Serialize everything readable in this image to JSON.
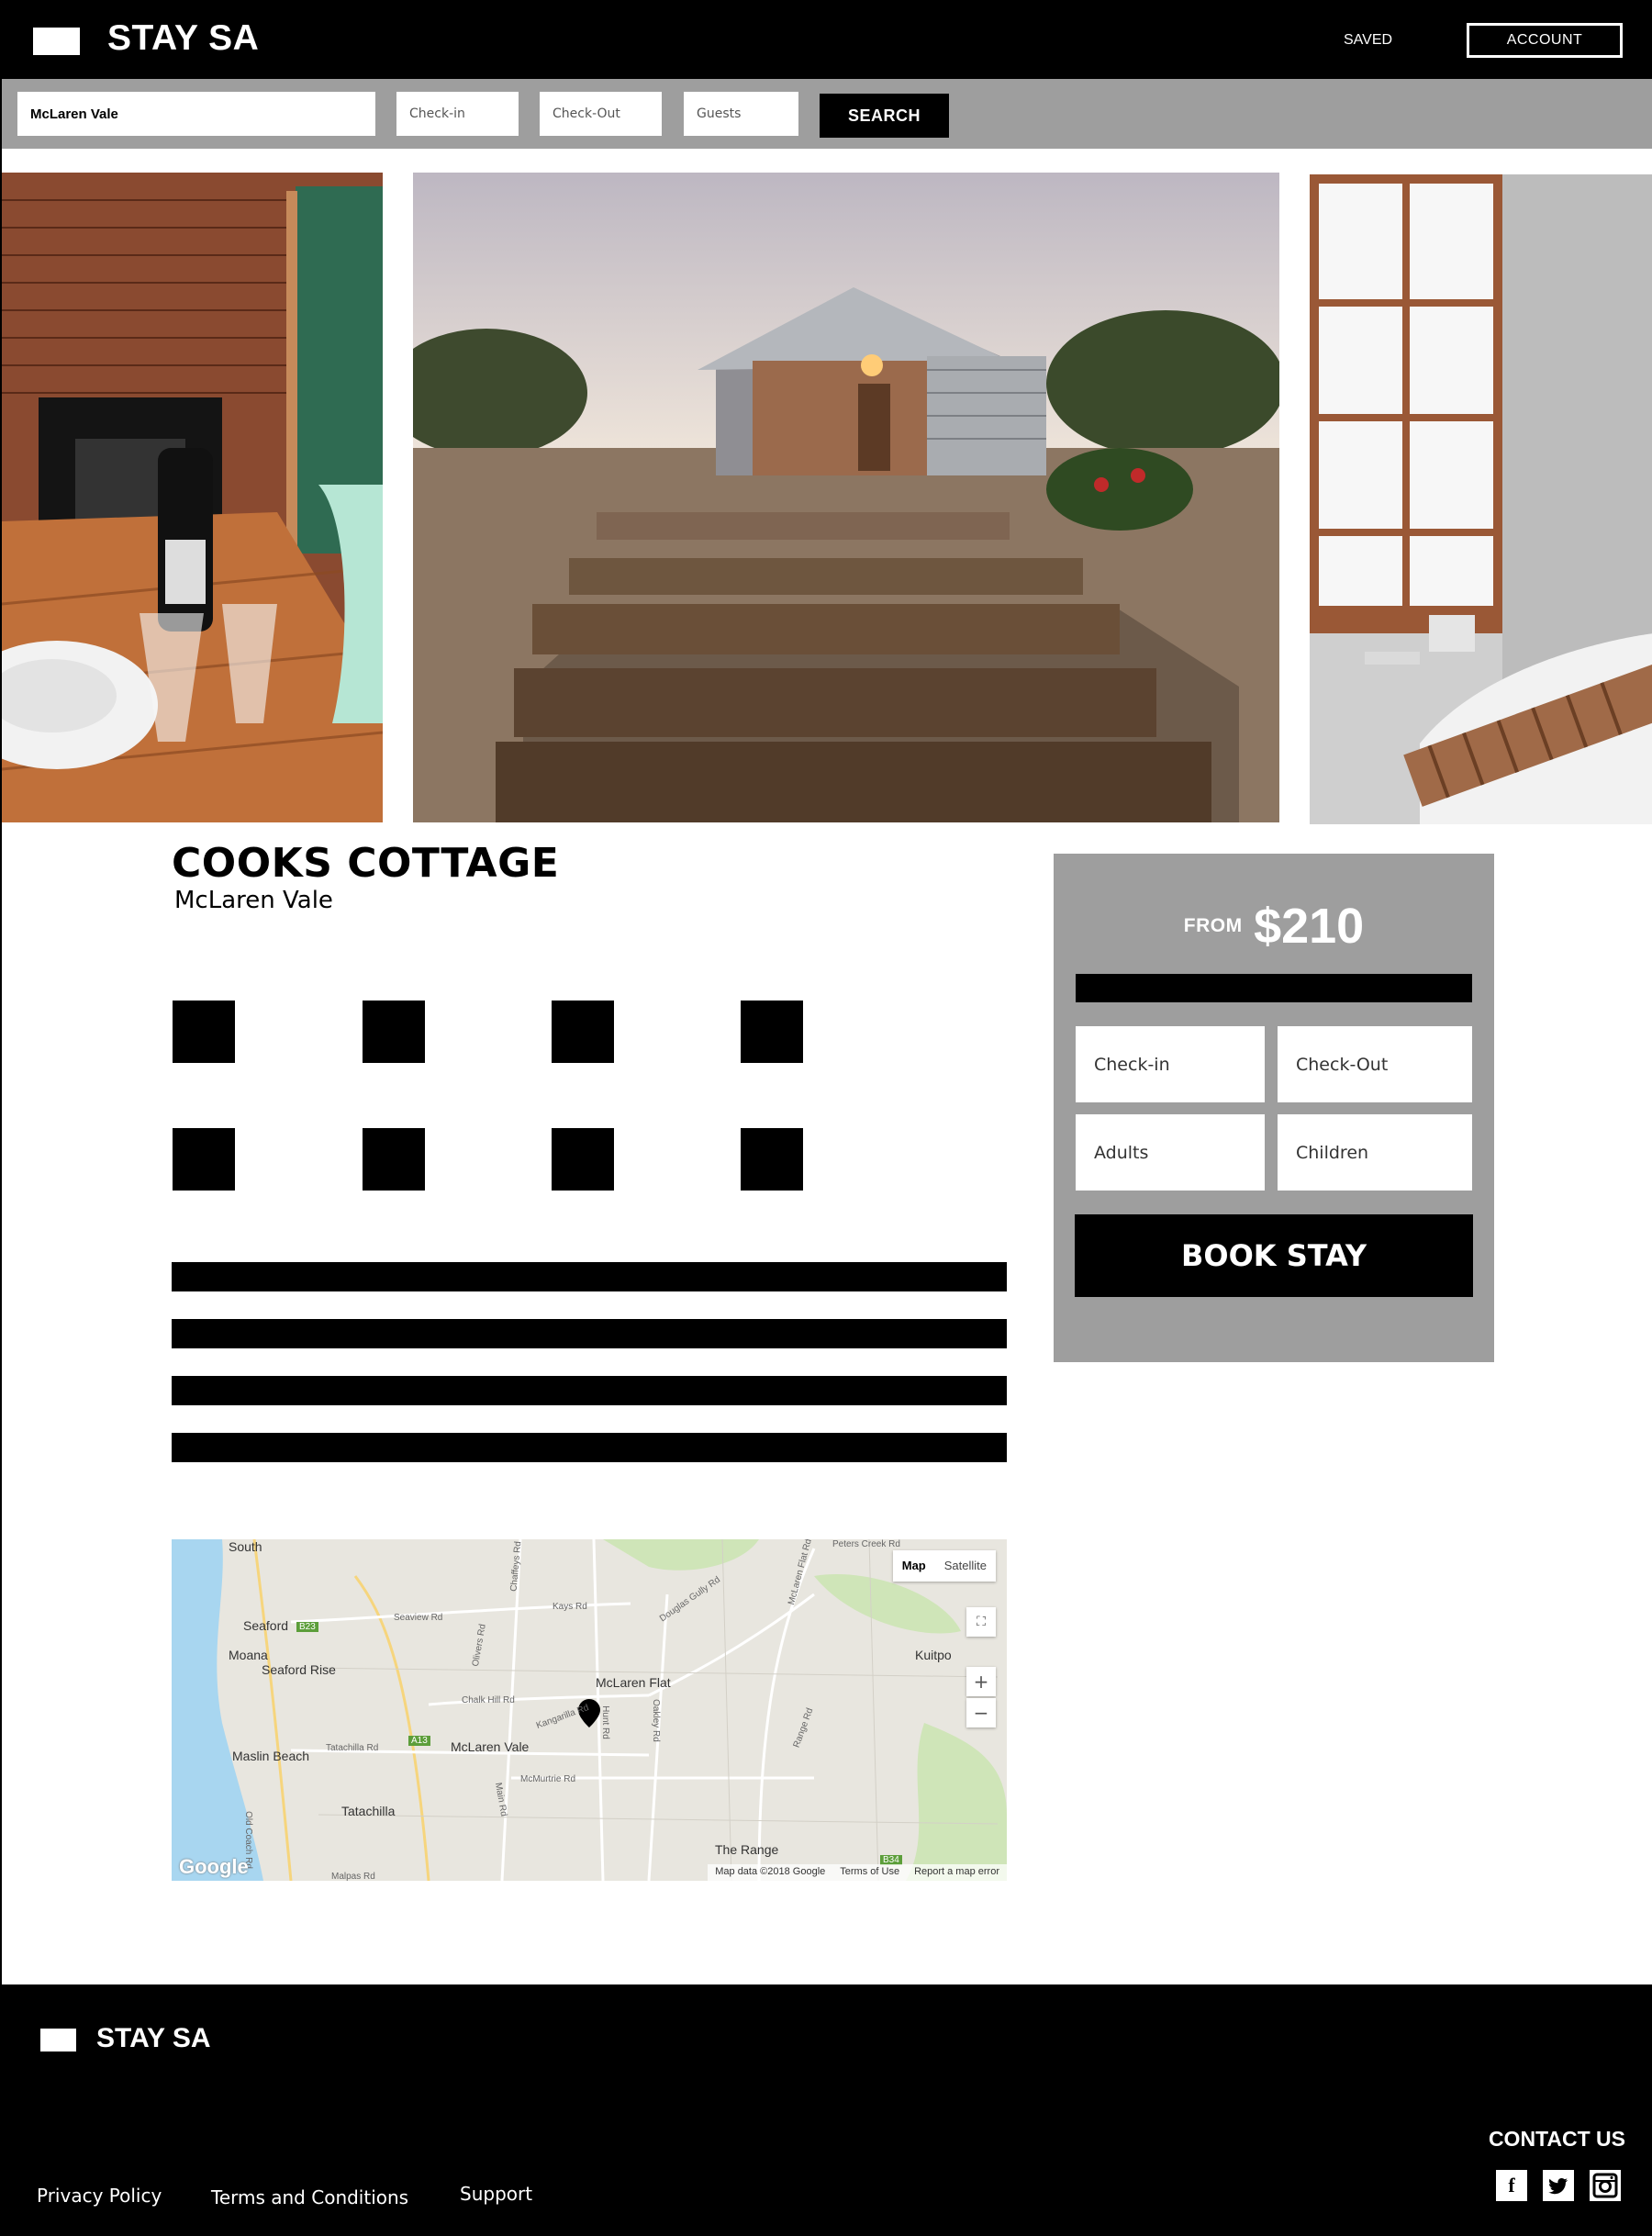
{
  "header": {
    "brand": "STAY SA",
    "saved": "SAVED",
    "account": "ACCOUNT"
  },
  "search": {
    "location_value": "McLaren Vale",
    "checkin_placeholder": "Check-in",
    "checkout_placeholder": "Check-Out",
    "guests_placeholder": "Guests",
    "search_label": "SEARCH"
  },
  "gallery": {
    "photos": [
      "dining-table-with-wine-photo",
      "cottage-exterior-photo",
      "bathroom-window-bathtub-photo"
    ]
  },
  "listing": {
    "title": "COOKS COTTAGE",
    "location": "McLaren Vale",
    "amenity_count": 8,
    "description_lines": 4
  },
  "map": {
    "type_map": "Map",
    "type_satellite": "Satellite",
    "zoom_in": "+",
    "zoom_out": "−",
    "places": [
      "South",
      "Seaford",
      "Moana",
      "Seaford Rise",
      "Maslin Beach",
      "McLaren Vale",
      "McLaren Flat",
      "Tatachilla",
      "Kuitpo",
      "The Range"
    ],
    "roads": [
      "Seaview Rd",
      "Chaffeys Rd",
      "Kays Rd",
      "Olivers Rd",
      "Chalk Hill Rd",
      "Tatachilla Rd",
      "McMurtrie Rd",
      "Main Rd",
      "Old Coach Rd",
      "Hunt Rd",
      "Oakley Rd",
      "Range Rd",
      "Douglas Gully Rd",
      "Kangarilla Rd",
      "Malpas Rd",
      "McLaren Flat Rd",
      "Peters Creek Rd"
    ],
    "badges": [
      "B23",
      "A13",
      "B34"
    ],
    "attribution": "Map data ©2018 Google",
    "terms": "Terms of Use",
    "report": "Report a map error",
    "google": "Google",
    "water_color": "#a8d6f0",
    "land_color": "#e8e6df",
    "park_color": "#cfe5b8"
  },
  "booking": {
    "from_label": "FROM",
    "price": "$210",
    "checkin_placeholder": "Check-in",
    "checkout_placeholder": "Check-Out",
    "adults_placeholder": "Adults",
    "children_placeholder": "Children",
    "book_label": "BOOK STAY"
  },
  "footer": {
    "brand": "STAY SA",
    "links": [
      "Privacy Policy",
      "Terms and Conditions",
      "Support"
    ],
    "contact": "CONTACT US",
    "social": [
      "facebook-icon",
      "twitter-icon",
      "instagram-icon"
    ]
  },
  "colors": {
    "header_bg": "#000000",
    "search_strip_bg": "#9e9e9e",
    "panel_bg": "#9e9e9e",
    "accent": "#000000"
  }
}
